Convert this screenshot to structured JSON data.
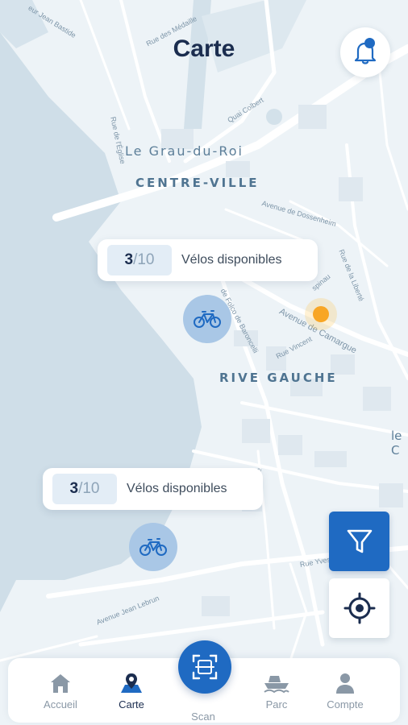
{
  "header": {
    "title": "Carte"
  },
  "map": {
    "town": "Le Grau-du-Roi",
    "district_centre": "CENTRE-VILLE",
    "district_rive": "RIVE GAUCHE",
    "edge_label": "le C",
    "streets": {
      "jean_bastide": "eur Jean Bastide",
      "medaille": "Rue des Médaille",
      "eglise": "Rue de l'Église",
      "quai_colbert": "Quai Colbert",
      "avenue_ouest": "Avenue de Dossenheim",
      "liberte": "Rue de la Liberté",
      "folco": "de Folco de Baroncelli",
      "camargue": "Avenue de Camargue",
      "vincent": "Rue Vincent",
      "espinau": "spinau",
      "marcel": "Rue Yves",
      "jean_lebrun": "Avenue Jean Lebrun",
      "vertical": "Avenue"
    }
  },
  "stations": [
    {
      "available": "3",
      "total": "/10",
      "label": "Vélos disponibles"
    },
    {
      "available": "3",
      "total": "/10",
      "label": "Vélos disponibles"
    }
  ],
  "nav": {
    "accueil": "Accueil",
    "carte": "Carte",
    "scan": "Scan",
    "parc": "Parc",
    "compte": "Compte"
  },
  "colors": {
    "primary": "#1f6ac2",
    "marker": "#a9c7e6",
    "user_location": "#f8a625",
    "title": "#1b2d4f"
  }
}
